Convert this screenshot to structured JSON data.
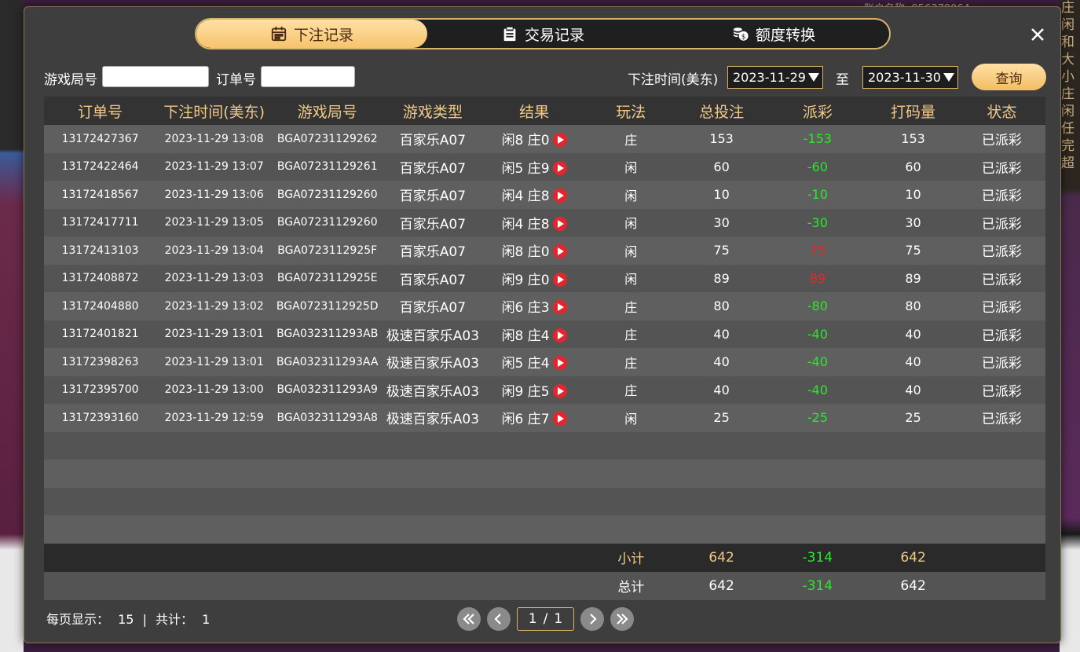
{
  "tabs": [
    {
      "label": "下注记录",
      "icon": "calendar-icon",
      "active": true
    },
    {
      "label": "交易记录",
      "icon": "clipboard-icon",
      "active": false
    },
    {
      "label": "额度转换",
      "icon": "coins-icon",
      "active": false
    }
  ],
  "filter": {
    "round_label": "游戏局号",
    "order_label": "订单号",
    "time_label": "下注时间(美东)",
    "date_from": "2023-11-29",
    "to_label": "至",
    "date_to": "2023-11-30",
    "query_label": "查询"
  },
  "table": {
    "headers": [
      "订单号",
      "下注时间(美东)",
      "游戏局号",
      "游戏类型",
      "结果",
      "玩法",
      "总投注",
      "派彩",
      "打码量",
      "状态"
    ],
    "rows": [
      {
        "order": "13172427367",
        "time": "2023-11-29 13:08",
        "round": "BGA07231129262",
        "game": "百家乐A07",
        "result": "闲8 庄0",
        "play": "庄",
        "bet": "153",
        "payout": "-153",
        "payout_sign": "neg",
        "valid": "153",
        "status": "已派彩"
      },
      {
        "order": "13172422464",
        "time": "2023-11-29 13:07",
        "round": "BGA07231129261",
        "game": "百家乐A07",
        "result": "闲5 庄9",
        "play": "闲",
        "bet": "60",
        "payout": "-60",
        "payout_sign": "neg",
        "valid": "60",
        "status": "已派彩"
      },
      {
        "order": "13172418567",
        "time": "2023-11-29 13:06",
        "round": "BGA07231129260",
        "game": "百家乐A07",
        "result": "闲4 庄8",
        "play": "闲",
        "bet": "10",
        "payout": "-10",
        "payout_sign": "neg",
        "valid": "10",
        "status": "已派彩"
      },
      {
        "order": "13172417711",
        "time": "2023-11-29 13:05",
        "round": "BGA07231129260",
        "game": "百家乐A07",
        "result": "闲4 庄8",
        "play": "闲",
        "bet": "30",
        "payout": "-30",
        "payout_sign": "neg",
        "valid": "30",
        "status": "已派彩"
      },
      {
        "order": "13172413103",
        "time": "2023-11-29 13:04",
        "round": "BGA0723112925F",
        "game": "百家乐A07",
        "result": "闲8 庄0",
        "play": "闲",
        "bet": "75",
        "payout": "75",
        "payout_sign": "pos",
        "valid": "75",
        "status": "已派彩"
      },
      {
        "order": "13172408872",
        "time": "2023-11-29 13:03",
        "round": "BGA0723112925E",
        "game": "百家乐A07",
        "result": "闲9 庄0",
        "play": "闲",
        "bet": "89",
        "payout": "89",
        "payout_sign": "pos",
        "valid": "89",
        "status": "已派彩"
      },
      {
        "order": "13172404880",
        "time": "2023-11-29 13:02",
        "round": "BGA0723112925D",
        "game": "百家乐A07",
        "result": "闲6 庄3",
        "play": "庄",
        "bet": "80",
        "payout": "-80",
        "payout_sign": "neg",
        "valid": "80",
        "status": "已派彩"
      },
      {
        "order": "13172401821",
        "time": "2023-11-29 13:01",
        "round": "BGA032311293AB",
        "game": "极速百家乐A03",
        "result": "闲8 庄4",
        "play": "庄",
        "bet": "40",
        "payout": "-40",
        "payout_sign": "neg",
        "valid": "40",
        "status": "已派彩"
      },
      {
        "order": "13172398263",
        "time": "2023-11-29 13:01",
        "round": "BGA032311293AA",
        "game": "极速百家乐A03",
        "result": "闲5 庄4",
        "play": "庄",
        "bet": "40",
        "payout": "-40",
        "payout_sign": "neg",
        "valid": "40",
        "status": "已派彩"
      },
      {
        "order": "13172395700",
        "time": "2023-11-29 13:00",
        "round": "BGA032311293A9",
        "game": "极速百家乐A03",
        "result": "闲9 庄5",
        "play": "庄",
        "bet": "40",
        "payout": "-40",
        "payout_sign": "neg",
        "valid": "40",
        "status": "已派彩"
      },
      {
        "order": "13172393160",
        "time": "2023-11-29 12:59",
        "round": "BGA032311293A8",
        "game": "极速百家乐A03",
        "result": "闲6 庄7",
        "play": "闲",
        "bet": "25",
        "payout": "-25",
        "payout_sign": "neg",
        "valid": "25",
        "status": "已派彩"
      }
    ],
    "empty_rows": 4,
    "subtotal": {
      "label": "小计",
      "bet": "642",
      "payout": "-314",
      "valid": "642"
    },
    "total": {
      "label": "总计",
      "bet": "642",
      "payout": "-314",
      "valid": "642"
    }
  },
  "footer": {
    "per_page_label": "每页显示：",
    "per_page_value": "15",
    "sep": "|",
    "total_label": "共计：",
    "total_value": "1",
    "page_current": "1",
    "page_sep": "/",
    "page_total": "1"
  },
  "background": {
    "right_column": [
      "庄",
      "闲",
      "和",
      "大",
      "小",
      "庄",
      "闲",
      "任",
      "完",
      "超"
    ],
    "top_text": "账户名称: 956379064"
  },
  "colors": {
    "accent": "#f6c46d",
    "negative": "#2ee62e",
    "positive": "#e02a2a",
    "header_text": "#f1c987"
  }
}
